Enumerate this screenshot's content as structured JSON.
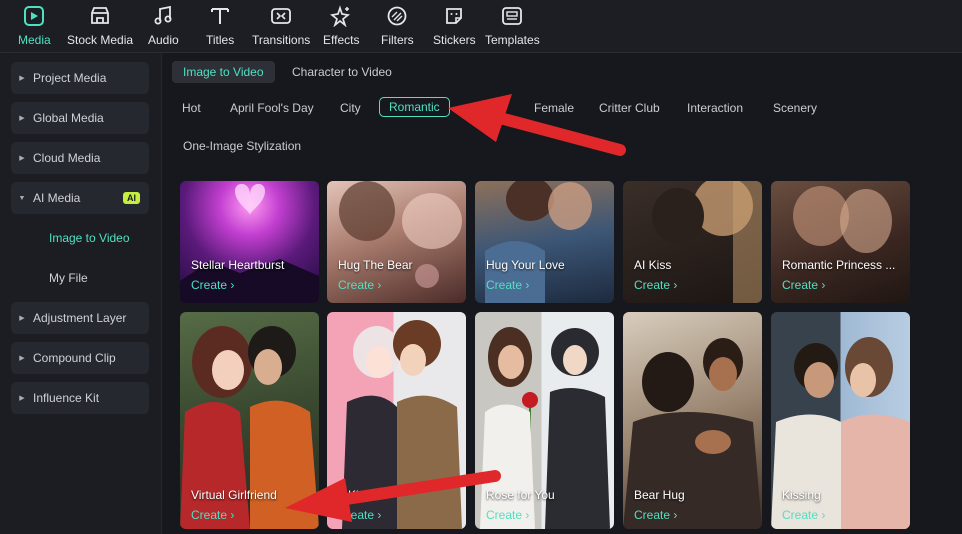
{
  "toolbar": {
    "items": [
      {
        "label": "Media",
        "icon": "media-icon",
        "active": true
      },
      {
        "label": "Stock Media",
        "icon": "stock-media-icon"
      },
      {
        "label": "Audio",
        "icon": "music-note-icon"
      },
      {
        "label": "Titles",
        "icon": "text-t-icon"
      },
      {
        "label": "Transitions",
        "icon": "transition-icon"
      },
      {
        "label": "Effects",
        "icon": "sparkle-star-icon"
      },
      {
        "label": "Filters",
        "icon": "filter-icon"
      },
      {
        "label": "Stickers",
        "icon": "sticker-icon"
      },
      {
        "label": "Templates",
        "icon": "template-icon"
      }
    ],
    "accent": "#4fe0c2"
  },
  "sidebar": {
    "items": [
      {
        "label": "Project Media"
      },
      {
        "label": "Global Media"
      },
      {
        "label": "Cloud Media"
      },
      {
        "label": "AI Media",
        "badge": "AI",
        "expanded": true
      },
      {
        "label": "Image to Video",
        "sub": true,
        "active": true
      },
      {
        "label": "My File",
        "sub": true
      },
      {
        "label": "Adjustment Layer"
      },
      {
        "label": "Compound Clip"
      },
      {
        "label": "Influence Kit"
      }
    ]
  },
  "main": {
    "tabs": [
      {
        "label": "Image to Video",
        "active": true
      },
      {
        "label": "Character to Video"
      }
    ],
    "categories": [
      {
        "label": "Hot"
      },
      {
        "label": "April Fool's Day"
      },
      {
        "label": "City"
      },
      {
        "label": "Romantic",
        "active": true
      },
      {
        "label": "Rol"
      },
      {
        "label": "Female"
      },
      {
        "label": "Critter Club"
      },
      {
        "label": "Interaction"
      },
      {
        "label": "Scenery"
      },
      {
        "label": "One-Image Stylization"
      }
    ],
    "cards": [
      {
        "title": "Stellar Heartburst",
        "create": "Create ›"
      },
      {
        "title": "Hug The Bear",
        "create": "Create ›"
      },
      {
        "title": "Hug Your Love",
        "create": "Create ›"
      },
      {
        "title": "AI Kiss",
        "create": "Create ›"
      },
      {
        "title": "Romantic Princess ...",
        "create": "Create ›"
      },
      {
        "title": "Virtual Girlfriend",
        "create": "Create ›"
      },
      {
        "title": "e Kiss",
        "create": "Create ›"
      },
      {
        "title": "Rose for You",
        "create": "Create ›"
      },
      {
        "title": "Bear Hug",
        "create": "Create ›"
      },
      {
        "title": "Kissing",
        "create": "Create ›"
      }
    ]
  },
  "annotations": {
    "arrow_color": "#e0282b"
  }
}
